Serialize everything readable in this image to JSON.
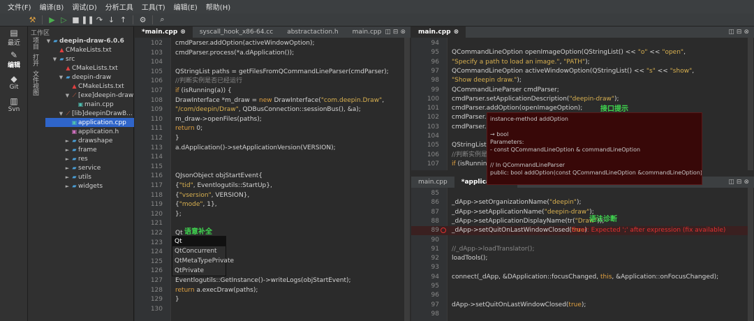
{
  "menu": [
    "文件(F)",
    "编译(B)",
    "调试(D)",
    "分析工具",
    "工具(T)",
    "编辑(E)",
    "帮助(H)"
  ],
  "modes": [
    {
      "label": "最近",
      "icon": "▤"
    },
    {
      "label": "编辑",
      "icon": "✎",
      "active": true
    },
    {
      "label": "Git",
      "icon": "◆"
    },
    {
      "label": "Svn",
      "icon": "▥"
    }
  ],
  "explorer": {
    "title": "工作区",
    "vtabs": [
      "项目",
      "打开",
      "文件视图"
    ],
    "tree": [
      {
        "d": 0,
        "arrow": "▼",
        "icon": "fd",
        "label": "deepin-draw-6.0.6",
        "bold": true
      },
      {
        "d": 1,
        "arrow": "",
        "icon": "cm",
        "label": "CMakeLists.txt"
      },
      {
        "d": 1,
        "arrow": "▼",
        "icon": "fd",
        "label": "src"
      },
      {
        "d": 2,
        "arrow": "",
        "icon": "cm",
        "label": "CMakeLists.txt"
      },
      {
        "d": 2,
        "arrow": "▼",
        "icon": "fd",
        "label": "deepin-draw"
      },
      {
        "d": 3,
        "arrow": "",
        "icon": "cm",
        "label": "CMakeLists.txt"
      },
      {
        "d": 3,
        "arrow": "▼",
        "icon": "ex",
        "label": "[exe]deepin-draw"
      },
      {
        "d": 4,
        "arrow": "",
        "icon": "cp",
        "label": "main.cpp"
      },
      {
        "d": 2,
        "arrow": "▼",
        "icon": "ex",
        "label": "[lib]deepinDrawB..."
      },
      {
        "d": 3,
        "arrow": "",
        "icon": "cp",
        "label": "application.cpp",
        "sel": true
      },
      {
        "d": 3,
        "arrow": "",
        "icon": "hh",
        "label": "application.h"
      },
      {
        "d": 3,
        "arrow": "►",
        "icon": "fd",
        "label": "drawshape"
      },
      {
        "d": 3,
        "arrow": "►",
        "icon": "fd",
        "label": "frame"
      },
      {
        "d": 3,
        "arrow": "►",
        "icon": "fd",
        "label": "res"
      },
      {
        "d": 3,
        "arrow": "►",
        "icon": "fd",
        "label": "service"
      },
      {
        "d": 3,
        "arrow": "►",
        "icon": "fd",
        "label": "utils"
      },
      {
        "d": 3,
        "arrow": "►",
        "icon": "fd",
        "label": "widgets"
      }
    ]
  },
  "left_tabs": [
    "*main.cpp",
    "syscall_hook_x86-64.cc",
    "abstractaction.h",
    "main.cpp"
  ],
  "right_top_tab": "main.cpp",
  "right_bottom_tabs": [
    "main.cpp",
    "*application.c"
  ],
  "left_editor": {
    "start": 102,
    "lines": [
      "    cmdParser.addOption(activeWindowOption);",
      "    cmdParser.process(*a.dApplication());",
      "",
      "    QStringList paths = getFilesFromQCommandLineParser(cmdParser);",
      "    //判断实例是否已经运行",
      "    if (isRunning(a)) {",
      "        DrawInterface *m_draw = new DrawInterface(\"com.deepin.Draw\",",
      "                                \"/com/deepin/Draw\", QDBusConnection::sessionBus(), &a);",
      "        m_draw->openFiles(paths);",
      "        return 0;",
      "    }",
      "    a.dApplication()->setApplicationVersion(VERSION);",
      "",
      "",
      "    QJsonObject objStartEvent{",
      "        {\"tid\", Eventlogutils::StartUp},",
      "        {\"vsersion\", VERSION},",
      "        {\"mode\", 1},",
      "    };",
      "",
      "    Qt",
      "",
      "                           []{",
      "                           w thread\";",
      "",
      "    Eventlogutils::GetInstance()->writeLogs(objStartEvent);",
      "    return a.execDraw(paths);",
      "}",
      ""
    ]
  },
  "completion": {
    "items": [
      "Qt",
      "QtConcurrent",
      "QtMetaTypePrivate",
      "QtPrivate"
    ]
  },
  "right_top_editor": {
    "start": 94,
    "lines": [
      "",
      "    QCommandLineOption openImageOption(QStringList() << \"o\" << \"open\",",
      "                                       \"Specify a path to load an image.\", \"PATH\");",
      "    QCommandLineOption activeWindowOption(QStringList() << \"s\" << \"show\",",
      "                                          \"Show deepin draw.\");",
      "    QCommandLineParser cmdParser;",
      "    cmdParser.setApplicationDescription(\"deepin-draw\");",
      "    cmdParser.addOption(openImageOption);",
      "    cmdParser.add",
      "    cmdParser.pro",
      "",
      "    QStringList pat",
      "    //判断实例是否",
      "    if (isRunning(a"
    ]
  },
  "hover": {
    "lines": [
      "instance-method addOption",
      "",
      "→ bool",
      "Parameters:",
      "- const QCommandLineOption & commandLineOption",
      "",
      "// In QCommandLineParser",
      "public: bool addOption(const QCommandLineOption &commandLineOption)"
    ]
  },
  "right_bottom_editor": {
    "start": 85,
    "lines": [
      "",
      "    _dApp->setOrganizationName(\"deepin\");",
      "    _dApp->setApplicationName(\"deepin-draw\");",
      "    _dApp->setApplicationDisplayName(tr(\"Draw\"));",
      "    _dApp->setQuitOnLastWindowClosed(true)",
      "",
      "    //_dApp->loadTranslator();",
      "    loadTools();",
      "",
      "    connect(_dApp, &DApplication::focusChanged, this, &Application::onFocusChanged);",
      "",
      "",
      "    dApp->setQuitOnLastWindowClosed(true);",
      ""
    ],
    "error_line": 89,
    "error_text": "Error: Expected ';' after expression (fix available)"
  },
  "annotations": {
    "completion": "语意补全",
    "hover": "接口提示",
    "diagnostic": "语法诊断"
  },
  "colors": {
    "accent": "#2f65ca",
    "annotation": "#3fd44f",
    "error": "#e03030",
    "hover_bg": "#380808"
  }
}
